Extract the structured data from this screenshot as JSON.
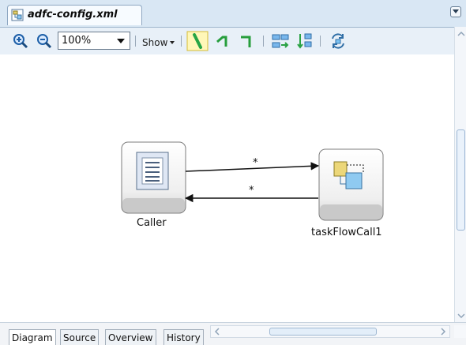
{
  "editor": {
    "tab_title": "adfc-config.xml"
  },
  "toolbar": {
    "zoom_value": "100%",
    "show_label": "Show"
  },
  "diagram": {
    "nodes": [
      {
        "label": "Caller"
      },
      {
        "label": "taskFlowCall1"
      }
    ],
    "edges": [
      {
        "label": "*"
      },
      {
        "label": "*"
      }
    ]
  },
  "view_tabs": [
    {
      "label": "Diagram",
      "active": true
    },
    {
      "label": "Source",
      "active": false
    },
    {
      "label": "Overview",
      "active": false
    },
    {
      "label": "History",
      "active": false
    }
  ],
  "colors": {
    "toolbar_background": "#e8f0f8",
    "node_border": "#7c7c7c",
    "node_footer": "#c9c9c9",
    "edge": "#111111"
  },
  "icons": {
    "zoom_in": "zoom-in-icon",
    "zoom_out": "zoom-out-icon",
    "straight_route": "straight-route-icon",
    "elbow_route": "elbow-route-icon",
    "orthogonal_route": "orthogonal-route-icon",
    "layout": "layout-icon",
    "align": "align-icon",
    "refresh": "refresh-icon"
  }
}
